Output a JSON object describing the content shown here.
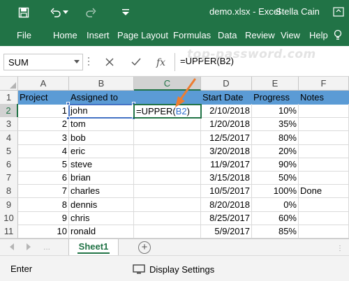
{
  "title_bar": {
    "filename": "demo.xlsx  -  Excel",
    "user": "Stella Cain"
  },
  "ribbon": {
    "tabs": [
      "File",
      "Home",
      "Insert",
      "Page Layout",
      "Formulas",
      "Data",
      "Review",
      "View",
      "Help"
    ]
  },
  "watermark": "top-password.com",
  "formula_bar": {
    "name_box": "SUM",
    "formula_prefix": "=UPPER(",
    "formula_ref": "B2",
    "formula_suffix": ")"
  },
  "grid": {
    "columns": [
      "A",
      "B",
      "C",
      "D",
      "E",
      "F"
    ],
    "active_column": "C",
    "active_row": "2",
    "header_row": {
      "row": "1",
      "cells": [
        "Project",
        "Assigned to",
        "",
        "Start Date",
        "Progress",
        "Notes"
      ]
    },
    "rows": [
      {
        "row": "2",
        "project": "1",
        "assigned": "john",
        "start": "2/10/2018",
        "progress": "10%",
        "notes": ""
      },
      {
        "row": "3",
        "project": "2",
        "assigned": "tom",
        "start": "1/20/2018",
        "progress": "35%",
        "notes": ""
      },
      {
        "row": "4",
        "project": "3",
        "assigned": "bob",
        "start": "12/5/2017",
        "progress": "80%",
        "notes": ""
      },
      {
        "row": "5",
        "project": "4",
        "assigned": "eric",
        "start": "3/20/2018",
        "progress": "20%",
        "notes": ""
      },
      {
        "row": "6",
        "project": "5",
        "assigned": "steve",
        "start": "11/9/2017",
        "progress": "90%",
        "notes": ""
      },
      {
        "row": "7",
        "project": "6",
        "assigned": "brian",
        "start": "3/15/2018",
        "progress": "50%",
        "notes": ""
      },
      {
        "row": "8",
        "project": "7",
        "assigned": "charles",
        "start": "10/5/2017",
        "progress": "100%",
        "notes": "Done"
      },
      {
        "row": "9",
        "project": "8",
        "assigned": "dennis",
        "start": "8/20/2018",
        "progress": "0%",
        "notes": ""
      },
      {
        "row": "10",
        "project": "9",
        "assigned": "chris",
        "start": "8/25/2017",
        "progress": "60%",
        "notes": ""
      },
      {
        "row": "11",
        "project": "10",
        "assigned": "ronald",
        "start": "5/9/2017",
        "progress": "85%",
        "notes": ""
      }
    ],
    "editing_cell": {
      "prefix": "=UPPER(",
      "ref": "B2",
      "suffix": ")"
    }
  },
  "sheets": {
    "active": "Sheet1",
    "nav_more": "..."
  },
  "status_bar": {
    "mode": "Enter",
    "display_settings": "Display Settings"
  },
  "colors": {
    "excel_green": "#217346",
    "header_fill": "#5b9bd5",
    "ref_blue": "#2f6fcf",
    "arrow_orange": "#ed7d31"
  }
}
